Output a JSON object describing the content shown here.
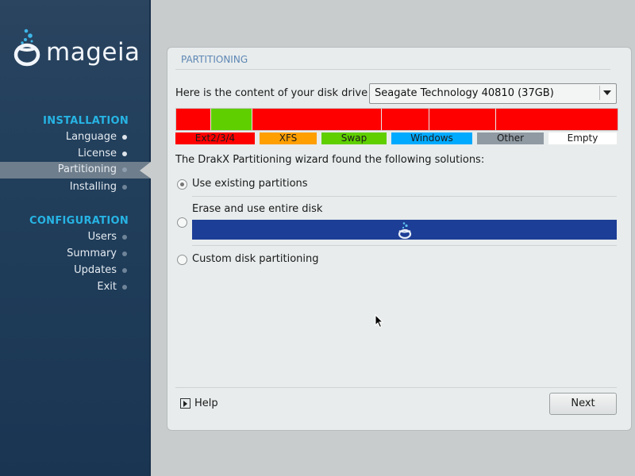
{
  "brand": {
    "name": "mageia"
  },
  "sidebar": {
    "installation_title": "INSTALLATION",
    "installation_items": [
      {
        "label": "Language"
      },
      {
        "label": "License"
      },
      {
        "label": "Partitioning"
      },
      {
        "label": "Installing"
      }
    ],
    "configuration_title": "CONFIGURATION",
    "configuration_items": [
      {
        "label": "Users"
      },
      {
        "label": "Summary"
      },
      {
        "label": "Updates"
      },
      {
        "label": "Exit"
      }
    ],
    "active_item": "Partitioning"
  },
  "panel": {
    "title": "PARTITIONING",
    "disk_label": "Here is the content of your disk drive",
    "disk_select_value": "Seagate Technology 40810 (37GB)",
    "legend": [
      {
        "label": "Ext2/3/4",
        "color": "#ff0000"
      },
      {
        "label": "XFS",
        "color": "#ff9f00"
      },
      {
        "label": "Swap",
        "color": "#5fcf00"
      },
      {
        "label": "Windows",
        "color": "#00aaff"
      },
      {
        "label": "Other",
        "color": "#8f9aa3"
      },
      {
        "label": "Empty",
        "color": "#ffffff"
      }
    ],
    "solutions_label": "The DrakX Partitioning wizard found the following solutions:",
    "options": [
      {
        "label": "Use existing partitions",
        "checked": true
      },
      {
        "label": "Erase and use entire disk",
        "checked": false
      },
      {
        "label": "Custom disk partitioning",
        "checked": false
      }
    ],
    "help_label": "Help",
    "next_label": "Next"
  },
  "colors": {
    "sidebar_bg": "#1e3b58",
    "section_title": "#27b4e4",
    "panel_title": "#5e87b5",
    "erase_bar": "#1d3e96"
  }
}
